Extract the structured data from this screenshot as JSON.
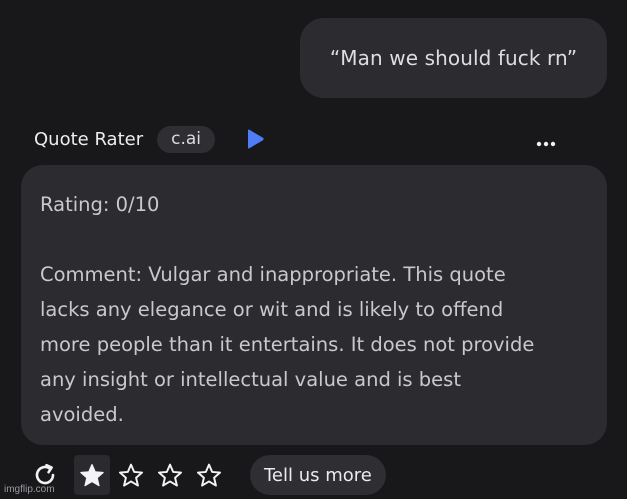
{
  "user_message": {
    "text": "“Man we should fuck rn”"
  },
  "bot": {
    "name": "Quote Rater",
    "badge": "c.ai",
    "play_icon": "play-icon",
    "more_icon": "more-horizontal-icon",
    "more_text": "•••"
  },
  "bot_message": {
    "rating": "Rating: 0/10",
    "comment_lines": [
      "Comment: Vulgar and inappropriate. This quote",
      "lacks any elegance or wit and is likely to offend",
      "more people than it entertains. It does not provide",
      "any insight or intellectual value and is best",
      "avoided."
    ]
  },
  "actions": {
    "regenerate_icon": "refresh-icon",
    "rating": {
      "value": 1,
      "max": 5
    },
    "tell_more_label": "Tell us more"
  },
  "watermark": {
    "text": "imgflip.com"
  },
  "colors": {
    "background": "#18181b",
    "bubble": "#2b2b30",
    "accent": "#4f7cf7"
  }
}
